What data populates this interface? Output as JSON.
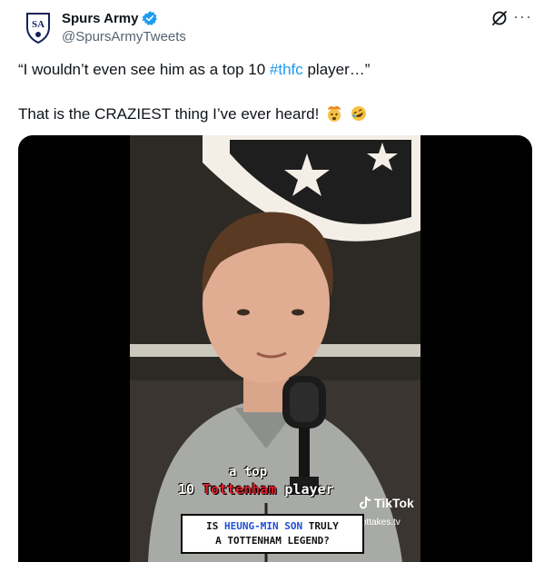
{
  "account": {
    "display_name": "Spurs Army",
    "handle": "@SpursArmyTweets",
    "avatar_text": "SA",
    "verified": true
  },
  "tweet": {
    "line1_prefix": "“I wouldn’t even see him as a top 10 ",
    "line1_hashtag": "#thfc",
    "line1_suffix": " player…”",
    "line2_text": "That is the CRAZIEST thing I’ve ever heard! ",
    "emojis": [
      "exploding-head-emoji",
      "rofl-emoji"
    ]
  },
  "video": {
    "caption_small": "a top",
    "caption_prefix": "10 ",
    "caption_red": "Tottenham",
    "caption_suffix": " player",
    "tiktok_label": "TikTok",
    "tiktok_handle": "ottakes.tv",
    "question_prefix": "IS ",
    "question_name": "HEUNG-MIN SON",
    "question_mid": " TRULY",
    "question_line2": "A TOTTENHAM LEGEND?"
  },
  "colors": {
    "link": "#1d9bf0",
    "verified": "#1d9bf0",
    "caption_red": "#e0222b",
    "question_blue": "#1f4fd6"
  }
}
